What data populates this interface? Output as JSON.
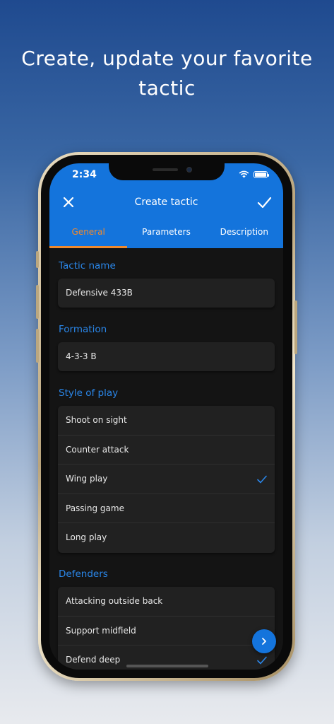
{
  "promo": {
    "headline_line1": "Create, update your favorite",
    "headline_line2": "tactic"
  },
  "status_bar": {
    "time": "2:34"
  },
  "toolbar": {
    "title": "Create tactic"
  },
  "tabs": [
    {
      "label": "General",
      "active": true
    },
    {
      "label": "Parameters",
      "active": false
    },
    {
      "label": "Description",
      "active": false
    }
  ],
  "tactic_name": {
    "label": "Tactic name",
    "value": "Defensive 433B"
  },
  "formation": {
    "label": "Formation",
    "value": "4-3-3 B"
  },
  "style_of_play": {
    "label": "Style of play",
    "options": [
      {
        "label": "Shoot on sight",
        "selected": false
      },
      {
        "label": "Counter attack",
        "selected": false
      },
      {
        "label": "Wing play",
        "selected": true
      },
      {
        "label": "Passing game",
        "selected": false
      },
      {
        "label": "Long play",
        "selected": false
      }
    ]
  },
  "defenders": {
    "label": "Defenders",
    "options": [
      {
        "label": "Attacking outside back",
        "selected": false
      },
      {
        "label": "Support midfield",
        "selected": false
      },
      {
        "label": "Defend deep",
        "selected": true
      }
    ]
  },
  "colors": {
    "primary": "#1474dc",
    "accent": "#f08a2e",
    "section": "#2a86e8",
    "card": "#212121"
  },
  "icons": {
    "close": "close-icon",
    "confirm": "check-icon",
    "next": "chevron-right-icon"
  }
}
